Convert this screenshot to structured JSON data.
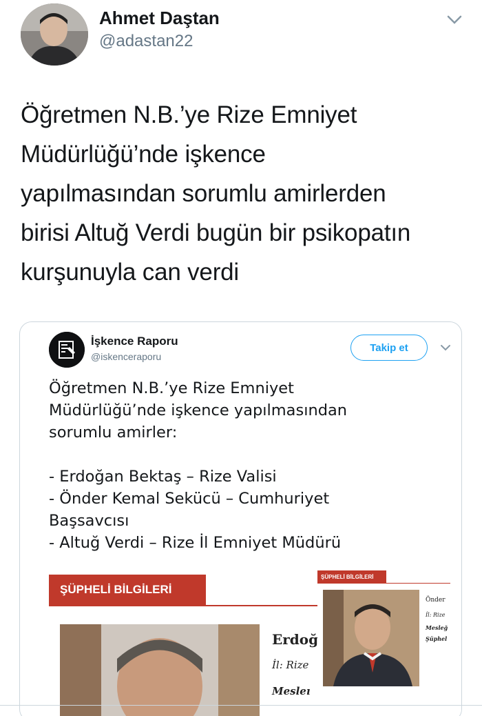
{
  "tweet": {
    "author_name": "Ahmet Daştan",
    "author_handle": "@adastan22",
    "text_lines": [
      "Öğretmen N.B.’ye Rize Emniyet",
      "Müdürlüğü’nde işkence",
      "yapılmasından sorumlu amirlerden",
      "birisi Altuğ Verdi bugün bir psikopatın",
      "kurşunuyla can verdi"
    ]
  },
  "quoted": {
    "author_name": "İşkence Raporu",
    "author_handle": "@iskenceraporu",
    "follow_label": "Takip et",
    "text_lines": [
      "Öğretmen N.B.’ye Rize Emniyet",
      "Müdürlüğü’nde işkence yapılmasından",
      "sorumlu amirler:",
      "",
      "- Erdoğan Bektaş – Rize Valisi",
      "- Önder Kemal Sekücü – Cumhuriyet",
      "Başsavcısı",
      "- Altuğ Verdi – Rize İl Emniyet Müdürü"
    ],
    "doc": {
      "header_label": "ŞÜPHELİ BİLGİLERİ",
      "name_partial": "Erdoğı",
      "il_label": "İl: Rize",
      "meslek_partial": "Mesleı",
      "inset_label": "ŞÜPHELİ BİLGİLERİ",
      "inset_name": "Önder",
      "inset_il": "İl: Rize",
      "inset_meslek": "Mesleğ",
      "inset_suphe": "Şüphel"
    }
  },
  "colors": {
    "accent": "#1da1f2",
    "doc_red": "#c0392b",
    "handle_gray": "#657786"
  }
}
